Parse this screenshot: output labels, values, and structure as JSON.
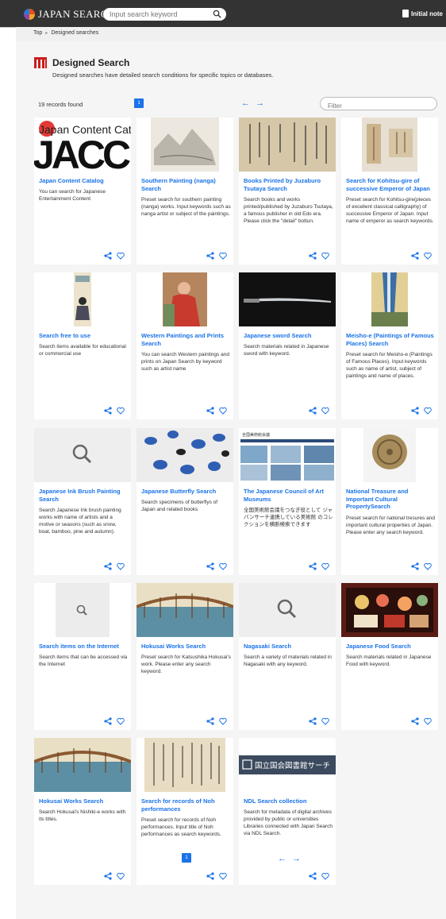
{
  "header": {
    "logo_text": "JAPAN SEARCH",
    "search_placeholder": "Input search keyword",
    "initial_note_label": "Initial note"
  },
  "breadcrumb": {
    "top": "Top",
    "current": "Designed searches"
  },
  "page": {
    "title": "Designed Search",
    "description": "Designed searches have detailed search conditions for specific topics or databases."
  },
  "list": {
    "record_count": "19 records found",
    "current_page": "1",
    "prev_arrow": "←",
    "next_arrow": "→",
    "filter_placeholder": "Filter"
  },
  "cards": [
    {
      "title": "Japan Content Catalog",
      "desc": "You can search for Japanese Entertainment Content",
      "thumb": "jacc-logo"
    },
    {
      "title": "Southern Painting (nanga) Search",
      "desc": "Preset search for southern painting (nanga) works. Input keywords such as nanga artist or subject of the paintings.",
      "thumb": "landscape-painting"
    },
    {
      "title": "Books Printed by Juzaburo Tsutaya Search",
      "desc": "Search books and works printed/published by Juzaburo Tsutaya, a famous publisher in old Edo era. Please click the \"detail\" bottun.",
      "thumb": "old-book"
    },
    {
      "title": "Search for Kohitsu-gire of successive Emperor of Japan",
      "desc": "Preset search for Kohitsu-gire(pieces of excellent classical calligraphy) of successive Emperor of Japan. Input name of emperor as search keywords.",
      "thumb": "calligraphy-scroll"
    },
    {
      "title": "Search free to use",
      "desc": "Search items available for educational or commercial use",
      "thumb": "portrait-scroll"
    },
    {
      "title": "Western Paintings and Prints Search",
      "desc": "You can search Western paintings and prints on Japan Search by keyword such as artist name",
      "thumb": "western-painting"
    },
    {
      "title": "Japanese sword Search",
      "desc": "Search materials related in Japanese sword with keyword.",
      "thumb": "sword"
    },
    {
      "title": "Meisho-e (Paintings of Famous Places) Search",
      "desc": "Preset search for Meisho-e (Paintings of Famous Places). Input keywords such as name of artist, subject of paintings and name of places.",
      "thumb": "waterfall-print"
    },
    {
      "title": "Japanese Ink Brush Painting Search",
      "desc": "Search Japanese Ink brush painting works with name of artists and a motive or seasons (such as snow, boat, bamboo, pine and autumn).",
      "thumb": "search-placeholder"
    },
    {
      "title": "Japanese Butterfly Search",
      "desc": "Search specimens of butterflys of Japan and related books",
      "thumb": "butterflies"
    },
    {
      "title": "The Japanese Council of Art Museums",
      "desc": "全国美術館会議をつなぎ役として ジャパンサーチ連携している美術館 のコレクションを横断検索できます",
      "thumb": "museum-site"
    },
    {
      "title": "National Treasure and Important Cultural PropertySearch",
      "desc": "Preset search for national tresures and important cultural properties of Japan. Please enter any search keyword.",
      "thumb": "bronze-mirror"
    },
    {
      "title": "Search items on the Internet",
      "desc": "Search items that can be accessed via the Internet",
      "thumb": "search-placeholder-small"
    },
    {
      "title": "Hokusai Works Search",
      "desc": "Preset search for Katsushika Hokusai's work. Please enter any search keyword.",
      "thumb": "bridge-print"
    },
    {
      "title": "Nagasaki Search",
      "desc": "Search a variety of materials related in Nagasaki with any keyword.",
      "thumb": "search-placeholder"
    },
    {
      "title": "Japanese Food Search",
      "desc": "Search materials related in Japanese Food with keyword.",
      "thumb": "bento"
    },
    {
      "title": "Hokusai Works Search",
      "desc": "Search Hokusai's Nishiki-e works with its titles.",
      "thumb": "bridge-print"
    },
    {
      "title": "Search for records of Noh performances",
      "desc": "Preset search for records of Noh performances. Input title of Noh performances as search keywords.",
      "thumb": "noh-document"
    },
    {
      "title": "NDL Search collection",
      "desc": "Search for metadata of digital archives provided by public or universities Libraries connected with Japan Search via NDL Search.",
      "thumb": "ndl-banner"
    }
  ],
  "thumb_text": {
    "jacc_top": "Japan Content Catalog",
    "jacc_big": "JACC",
    "ndl": "国立国会図書館サーチ",
    "museum_header": "全国美術館会議"
  },
  "colors": {
    "accent": "#1a73e8",
    "header_bg": "#333333",
    "logo_red": "#cc1c1c"
  }
}
